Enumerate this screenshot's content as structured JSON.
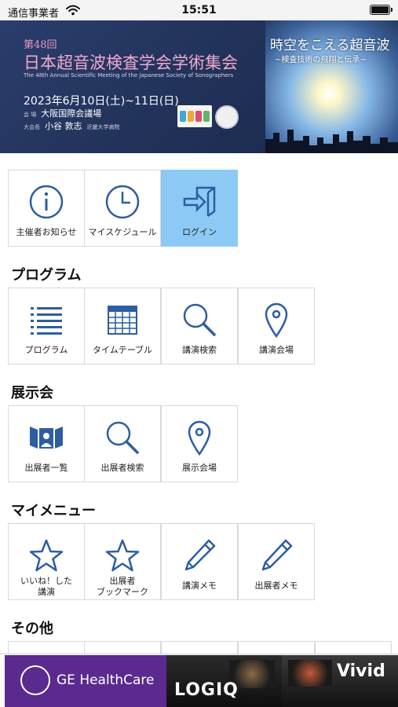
{
  "statusbar": {
    "carrier": "通信事業者",
    "time": "15:51",
    "battery_level": 1.0
  },
  "banner": {
    "session": "第48回",
    "title": "日本超音波検査学会学術集会",
    "english": "The 48th Annual Scientific Meeting of the Japanese Society of Sonographers",
    "date": "2023年6月10日(土)~11日(日)",
    "venue_label": "会 場",
    "venue": "大阪国際会議場",
    "chair_label": "大会長",
    "chair": "小谷 敦志",
    "chair_affiliation": "近畿大学病院",
    "theme": "時空をこえる超音波",
    "theme_sub": "~検査技術の飛翔と伝承~"
  },
  "top": {
    "items": [
      {
        "label": "主催者お知らせ",
        "icon": "info-icon"
      },
      {
        "label": "マイスケジュール",
        "icon": "clock-icon"
      },
      {
        "label": "ログイン",
        "icon": "login-icon",
        "active": true
      }
    ]
  },
  "program": {
    "title": "プログラム",
    "items": [
      {
        "label": "プログラム",
        "icon": "list-icon"
      },
      {
        "label": "タイムテーブル",
        "icon": "calendar-icon"
      },
      {
        "label": "講演検索",
        "icon": "search-icon"
      },
      {
        "label": "講演会場",
        "icon": "map-pin-icon"
      }
    ]
  },
  "exhibition": {
    "title": "展示会",
    "items": [
      {
        "label": "出展者一覧",
        "icon": "exhibitor-icon"
      },
      {
        "label": "出展者検索",
        "icon": "search-icon"
      },
      {
        "label": "展示会場",
        "icon": "map-pin-icon"
      }
    ]
  },
  "mymenu": {
    "title": "マイメニュー",
    "items": [
      {
        "label1": "いいね！した",
        "label2": "講演",
        "icon": "star-icon"
      },
      {
        "label1": "出展者",
        "label2": "ブックマーク",
        "icon": "star-icon"
      },
      {
        "label": "講演メモ",
        "icon": "pencil-icon"
      },
      {
        "label": "出展者メモ",
        "icon": "pencil-icon"
      }
    ]
  },
  "other": {
    "title": "その他"
  },
  "ads": {
    "ge": "GE HealthCare",
    "logiq": "LOGIQ",
    "vivid": "Vivid"
  },
  "colors": {
    "icon": "#2d5da3",
    "active_tile": "#8ccaf5",
    "ge_purple": "#5a2a8f"
  }
}
